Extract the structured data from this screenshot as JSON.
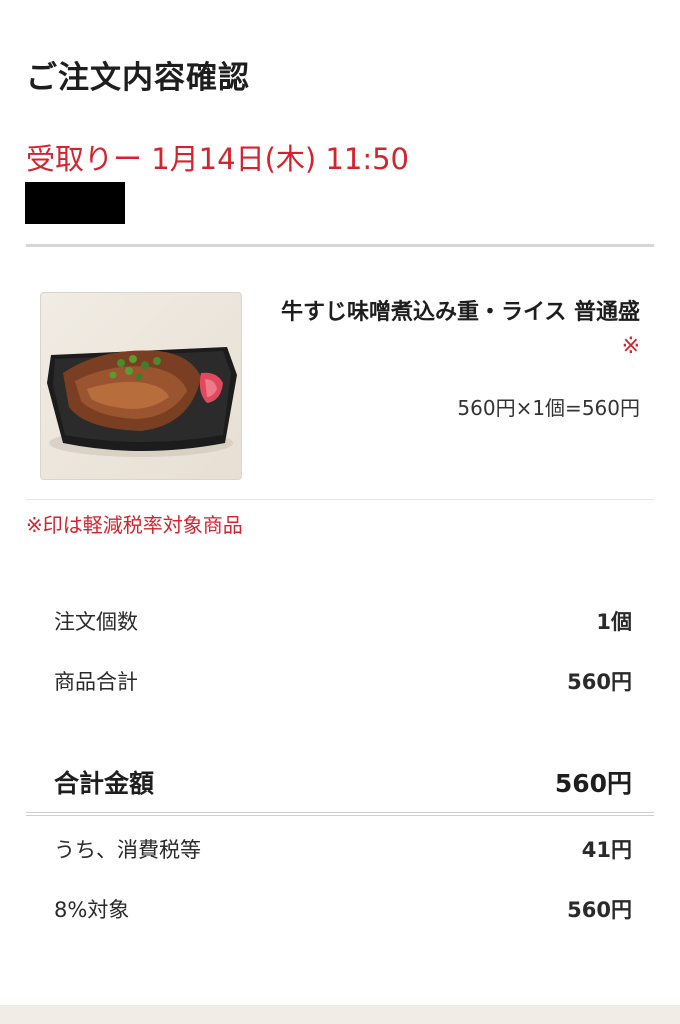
{
  "page": {
    "title": "ご注文内容確認"
  },
  "pickup": {
    "text": "受取りー 1月14日(木) 11:50"
  },
  "product": {
    "image_alt": "牛すじ味噌煮込み重 弁当",
    "name": "牛すじ味噌煮込み重・ライス 普通盛",
    "reduced_tax_mark": "※",
    "price_line": "560円×1個=560円"
  },
  "tax_note": "※印は軽減税率対象商品",
  "summary": {
    "quantity_label": "注文個数",
    "quantity_value": "1個",
    "subtotal_label": "商品合計",
    "subtotal_value": "560円",
    "total_label": "合計金額",
    "total_value": "560円",
    "tax_label": "うち、消費税等",
    "tax_value": "41円",
    "rate_label": "8%対象",
    "rate_value": "560円"
  },
  "colors": {
    "accent_red": "#d5232e",
    "text": "#222222",
    "divider": "#d6d6d6",
    "footer_band": "#f1ece6"
  }
}
